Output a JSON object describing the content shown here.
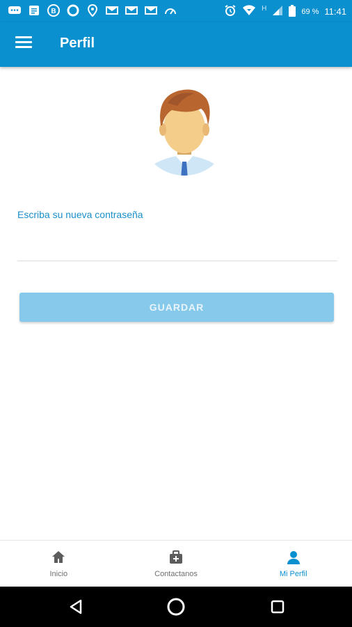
{
  "status_bar": {
    "left_icons": [
      "message-icon",
      "notes-icon",
      "b-app-icon",
      "circle-app-icon",
      "location-icon",
      "gmail-icon",
      "gmail-icon",
      "gmail-icon",
      "speedometer-icon"
    ],
    "right_icons": [
      "alarm-icon",
      "wifi-icon",
      "signal-icon",
      "battery-icon"
    ],
    "network_type": "H",
    "battery": "69 %",
    "time": "11:41"
  },
  "app_bar": {
    "title": "Perfil",
    "menu_icon": "hamburger-menu-icon"
  },
  "profile": {
    "avatar_icon": "user-avatar-icon",
    "password_label": "Escriba su nueva contraseña",
    "password_value": "",
    "password_placeholder": ""
  },
  "save_button": {
    "label": "GUARDAR"
  },
  "bottom_nav": {
    "items": [
      {
        "label": "Inicio",
        "icon": "home-icon",
        "active": false
      },
      {
        "label": "Contactanos",
        "icon": "medkit-icon",
        "active": false
      },
      {
        "label": "Mi Perfil",
        "icon": "person-icon",
        "active": true
      }
    ]
  },
  "system_nav": {
    "icons": [
      "back-icon",
      "home-circle-icon",
      "recents-icon"
    ]
  },
  "colors": {
    "primary": "#0a8fcf",
    "button": "#86c9ea",
    "label": "#1a8ec9",
    "nav_inactive": "#6e6e6e",
    "system_bar": "#000000"
  }
}
